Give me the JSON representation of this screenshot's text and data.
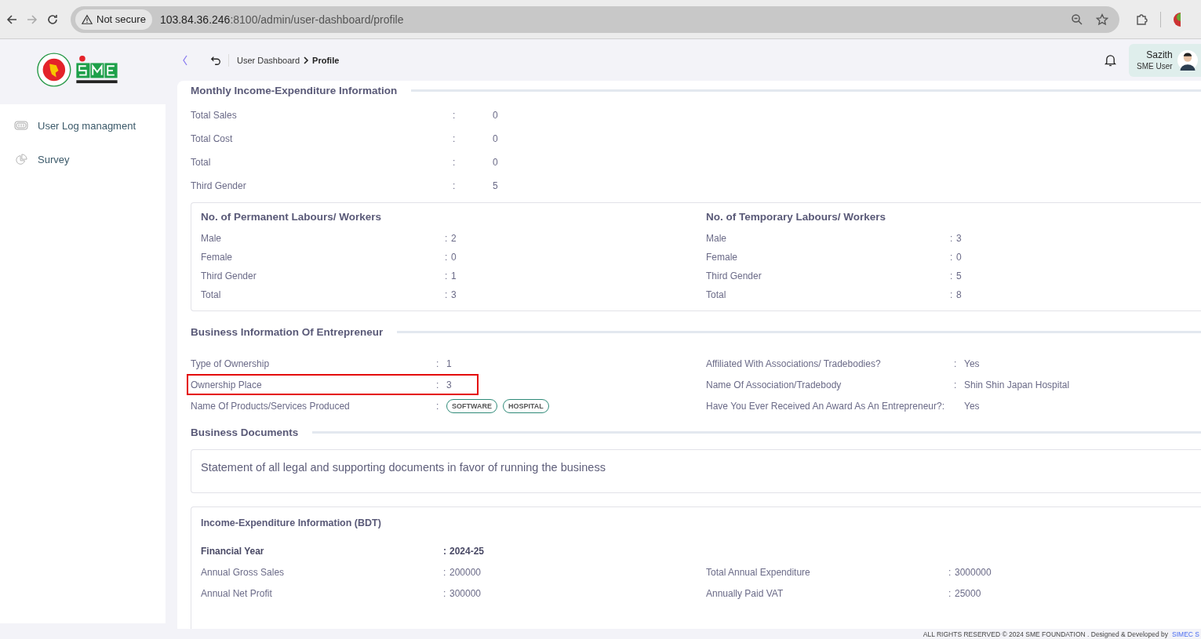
{
  "browser": {
    "security": "Not secure",
    "url_host": "103.84.36.246",
    "url_rest": ":8100/admin/user-dashboard/profile"
  },
  "sidebar": {
    "items": [
      {
        "label": "User Log managment",
        "kind": "log"
      },
      {
        "label": "Survey",
        "kind": "chart"
      }
    ]
  },
  "header": {
    "breadcrumb": [
      "User Dashboard",
      "Profile"
    ],
    "user": {
      "name": "Sazith",
      "role": "SME User"
    }
  },
  "monthly": {
    "title": "Monthly Income-Expenditure Information",
    "rows": [
      {
        "label": "Total Sales",
        "colon": ":",
        "value": "0"
      },
      {
        "label": "Total Cost",
        "colon": ":",
        "value": "0"
      },
      {
        "label": "Total",
        "colon": ":",
        "value": "0"
      },
      {
        "label": "Third Gender",
        "colon": ":",
        "value": "5"
      }
    ]
  },
  "labours": [
    {
      "title": "No. of Permanent Labours/ Workers",
      "rows": [
        {
          "label": "Male",
          "colon": ":",
          "value": "2"
        },
        {
          "label": "Female",
          "colon": ":",
          "value": "0"
        },
        {
          "label": "Third Gender",
          "colon": ":",
          "value": "1"
        },
        {
          "label": "Total",
          "colon": ":",
          "value": "3"
        }
      ]
    },
    {
      "title": "No. of Temporary Labours/ Workers",
      "rows": [
        {
          "label": "Male",
          "colon": ":",
          "value": "3"
        },
        {
          "label": "Female",
          "colon": ":",
          "value": "0"
        },
        {
          "label": "Third Gender",
          "colon": ":",
          "value": "5"
        },
        {
          "label": "Total",
          "colon": ":",
          "value": "8"
        }
      ]
    }
  ],
  "business": {
    "title": "Business Information Of Entrepreneur",
    "left": [
      {
        "label": "Type of Ownership",
        "colon": ":",
        "value": "1",
        "highlighted": false
      },
      {
        "label": "Ownership Place",
        "colon": ":",
        "value": "3",
        "highlighted": true
      },
      {
        "label": "Name Of Products/Services Produced",
        "colon": ":",
        "tags": [
          "SOFTWARE",
          "HOSPITAL"
        ],
        "highlighted": false
      }
    ],
    "right": [
      {
        "label": "Affiliated With Associations/ Tradebodies?",
        "colon": ":",
        "value": "Yes"
      },
      {
        "label": "Name Of Association/Tradebody",
        "colon": ":",
        "value": "Shin Shin Japan Hospital"
      },
      {
        "label": "Have You Ever Received An Award As An Entrepreneur?:",
        "value": "Yes"
      }
    ]
  },
  "documents": {
    "title": "Business Documents",
    "statement": "Statement of all legal and supporting documents in favor of running the business"
  },
  "income": {
    "title": "Income-Expenditure Information (BDT)",
    "year_label": "Financial Year",
    "year_colon": ":",
    "year": "2024-25",
    "rows": [
      {
        "label": "Annual Gross Sales",
        "colon": ":",
        "value": "200000"
      },
      {
        "label": "Total Annual Expenditure",
        "colon": ":",
        "value": "3000000"
      },
      {
        "label": "Annual Net Profit",
        "colon": ":",
        "value": "300000"
      },
      {
        "label": "Annually Paid VAT",
        "colon": ":",
        "value": "25000"
      }
    ]
  },
  "footer": {
    "text": "ALL RIGHTS RESERVED © 2024 SME FOUNDATION . Designed & Developed by",
    "link": "SIMEC S"
  }
}
